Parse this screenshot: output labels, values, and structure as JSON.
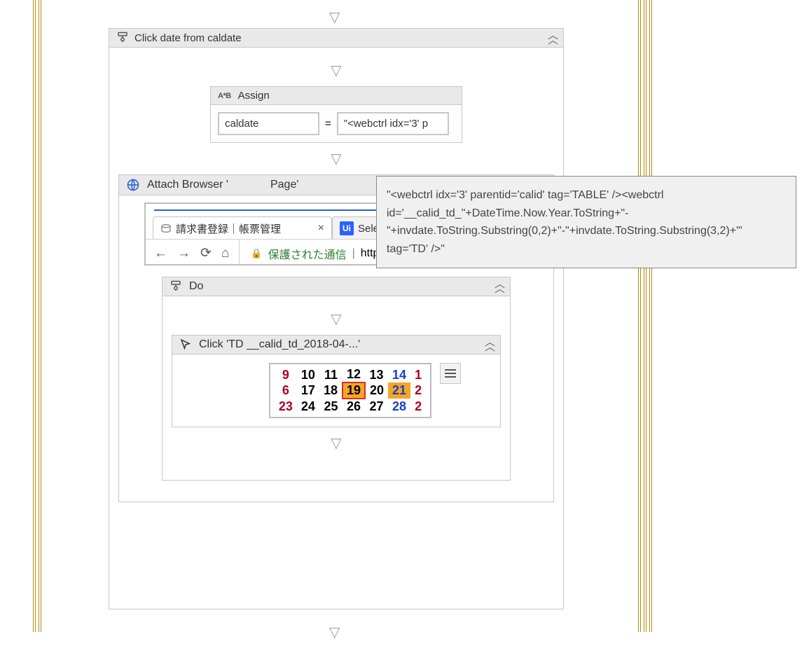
{
  "outer_sequence": {
    "title": "Click date from caldate"
  },
  "assign": {
    "label": "Assign",
    "to": "caldate",
    "eq": "=",
    "value": "\"<webctrl idx='3' p"
  },
  "tooltip": {
    "text": "\"<webctrl idx='3' parentid='calid' tag='TABLE' /><webctrl id='__calid_td_\"+DateTime.Now.Year.ToString+\"-\"+invdate.ToString.Substring(0,2)+\"-\"+invdate.ToString.Substring(3,2)+\"' tag='TD' />\""
  },
  "attach_browser": {
    "title_prefix": "Attach Browser '",
    "title_suffix": "Page'"
  },
  "browser_shot": {
    "tab1": {
      "label": "請求書登録｜帳票管理"
    },
    "tab2": {
      "icon": "Ui",
      "label": "Select dynamic date form"
    },
    "secure": "保護された通信",
    "url": "https://shimiz.synolo"
  },
  "do": {
    "title": "Do"
  },
  "click": {
    "title": "Click 'TD  __calid_td_2018-04-...'"
  },
  "calendar": {
    "rows": [
      [
        {
          "t": "9",
          "cls": "edge"
        },
        {
          "t": "10"
        },
        {
          "t": "11"
        },
        {
          "t": "12"
        },
        {
          "t": "13"
        },
        {
          "t": "14",
          "cls": "blue"
        },
        {
          "t": "1",
          "cls": "edge"
        }
      ],
      [
        {
          "t": "6",
          "cls": "edge"
        },
        {
          "t": "17"
        },
        {
          "t": "18"
        },
        {
          "t": "19",
          "cls": "sel"
        },
        {
          "t": "20"
        },
        {
          "t": "21",
          "cls": "hi"
        },
        {
          "t": "2",
          "cls": "edge"
        }
      ],
      [
        {
          "t": "23",
          "cls": "edge"
        },
        {
          "t": "24"
        },
        {
          "t": "25"
        },
        {
          "t": "26"
        },
        {
          "t": "27"
        },
        {
          "t": "28",
          "cls": "blue"
        },
        {
          "t": "2",
          "cls": "edge"
        }
      ]
    ]
  }
}
